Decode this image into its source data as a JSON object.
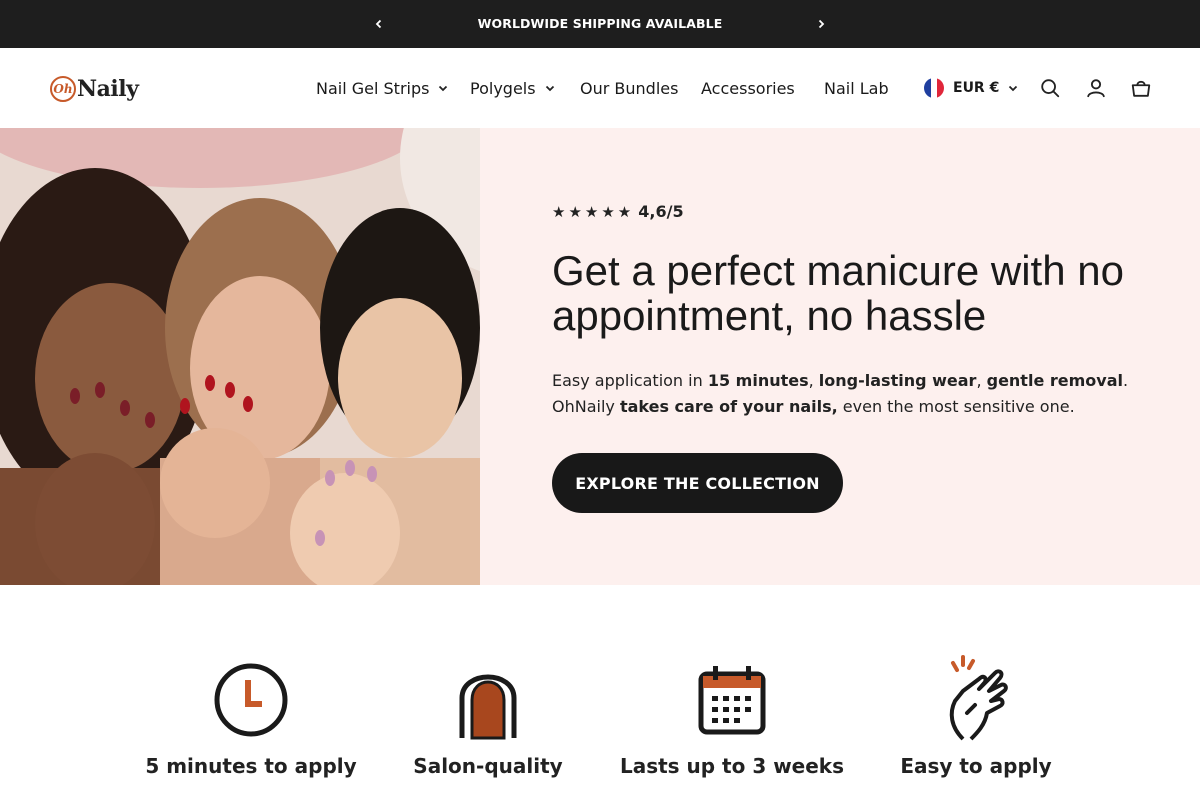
{
  "announcement": {
    "text": "WORLDWIDE SHIPPING AVAILABLE"
  },
  "brand": {
    "logo_mark": "Oh",
    "logo_word": "Naily"
  },
  "nav": {
    "items": [
      {
        "label": "Nail Gel Strips",
        "has_dropdown": true
      },
      {
        "label": "Polygels",
        "has_dropdown": true
      },
      {
        "label": "Our Bundles",
        "has_dropdown": false
      },
      {
        "label": "Accessories",
        "has_dropdown": false
      },
      {
        "label": "Nail Lab",
        "has_dropdown": false
      }
    ]
  },
  "currency": {
    "label": "EUR €",
    "flag": "france-flag-icon"
  },
  "header_icons": [
    "search-icon",
    "account-icon",
    "cart-icon"
  ],
  "hero": {
    "rating": {
      "stars": "★★★★★",
      "score": "4,6/5"
    },
    "headline": "Get a perfect manicure with no appointment, no hassle",
    "sub": {
      "p1": "Easy application in ",
      "b1": "15 minutes",
      "p2": ", ",
      "b2": "long-lasting wear",
      "p3": ", ",
      "b3": "gentle removal",
      "p4": ". OhNaily ",
      "b4": "takes care of your nails,",
      "p5": " even the most sensitive one."
    },
    "cta": "EXPLORE THE COLLECTION"
  },
  "features": [
    {
      "label": "5 minutes to apply",
      "icon": "clock-icon"
    },
    {
      "label": "Salon-quality",
      "icon": "nail-icon"
    },
    {
      "label": "Lasts up to 3 weeks",
      "icon": "calendar-icon"
    },
    {
      "label": "Easy to apply",
      "icon": "hand-icon"
    }
  ],
  "colors": {
    "accent": "#c75a2a",
    "dark": "#1e1e1e",
    "hero_bg": "#fdf0ee"
  }
}
